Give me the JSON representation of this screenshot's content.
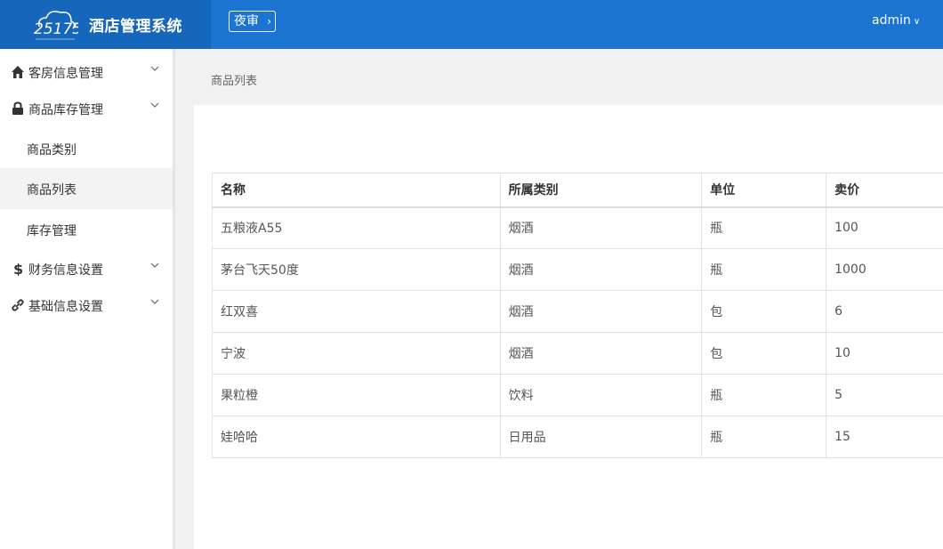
{
  "header": {
    "logo_text": "酒店管理系统",
    "logo_mark": "25175",
    "night_audit_label": "夜审",
    "user_label": "admin",
    "colors": {
      "bar": "#1a75d2",
      "logo_bg": "#1667bb"
    }
  },
  "sidebar": {
    "groups": [
      {
        "label": "客房信息管理",
        "icon": "home-icon"
      },
      {
        "label": "商品库存管理",
        "icon": "lock-icon"
      },
      {
        "label": "财务信息设置",
        "icon": "dollar-icon"
      },
      {
        "label": "基础信息设置",
        "icon": "link-icon"
      }
    ],
    "sub_items": [
      {
        "label": "商品类别"
      },
      {
        "label": "商品列表",
        "active": true
      },
      {
        "label": "库存管理"
      }
    ]
  },
  "breadcrumb": "商品列表",
  "table": {
    "headers": [
      "名称",
      "所属类别",
      "单位",
      "卖价"
    ],
    "rows": [
      [
        "五粮液A55",
        "烟酒",
        "瓶",
        "100"
      ],
      [
        "茅台飞天50度",
        "烟酒",
        "瓶",
        "1000"
      ],
      [
        "红双喜",
        "烟酒",
        "包",
        "6"
      ],
      [
        "宁波",
        "烟酒",
        "包",
        "10"
      ],
      [
        "果粒橙",
        "饮料",
        "瓶",
        "5"
      ],
      [
        "娃哈哈",
        "日用品",
        "瓶",
        "15"
      ]
    ]
  }
}
